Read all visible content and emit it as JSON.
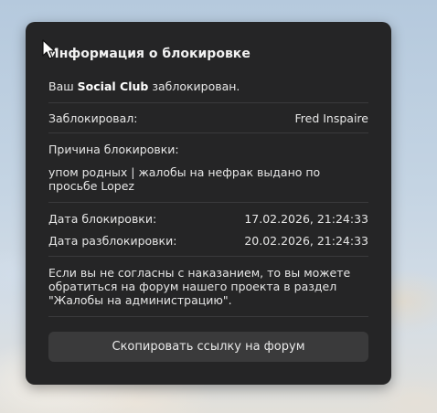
{
  "dialog": {
    "title": "Информация о блокировке",
    "account_prefix": "Ваш",
    "account_name": "Social Club",
    "account_suffix": "заблокирован.",
    "blocked_by_label": "Заблокировал:",
    "blocked_by_value": "Fred Inspaire",
    "reason_label": "Причина блокировки:",
    "reason_value": "упом родных | жалобы на нефрак выдано по просьбе Lopez",
    "block_date_label": "Дата блокировки:",
    "block_date_value": "17.02.2026, 21:24:33",
    "unblock_date_label": "Дата разблокировки:",
    "unblock_date_value": "20.02.2026, 21:24:33",
    "appeal_text": "Если вы не согласны с наказанием, то вы можете обратиться на форум нашего проекта в раздел \"Жалобы на администрацию\".",
    "copy_button_label": "Скопировать ссылку на форум"
  },
  "colors": {
    "panel_bg": "#252526",
    "button_bg": "#3a3a3b",
    "divider": "#3a3a3c",
    "text": "#e6e6e6"
  },
  "icons": {
    "cursor": "mouse-pointer-icon"
  }
}
